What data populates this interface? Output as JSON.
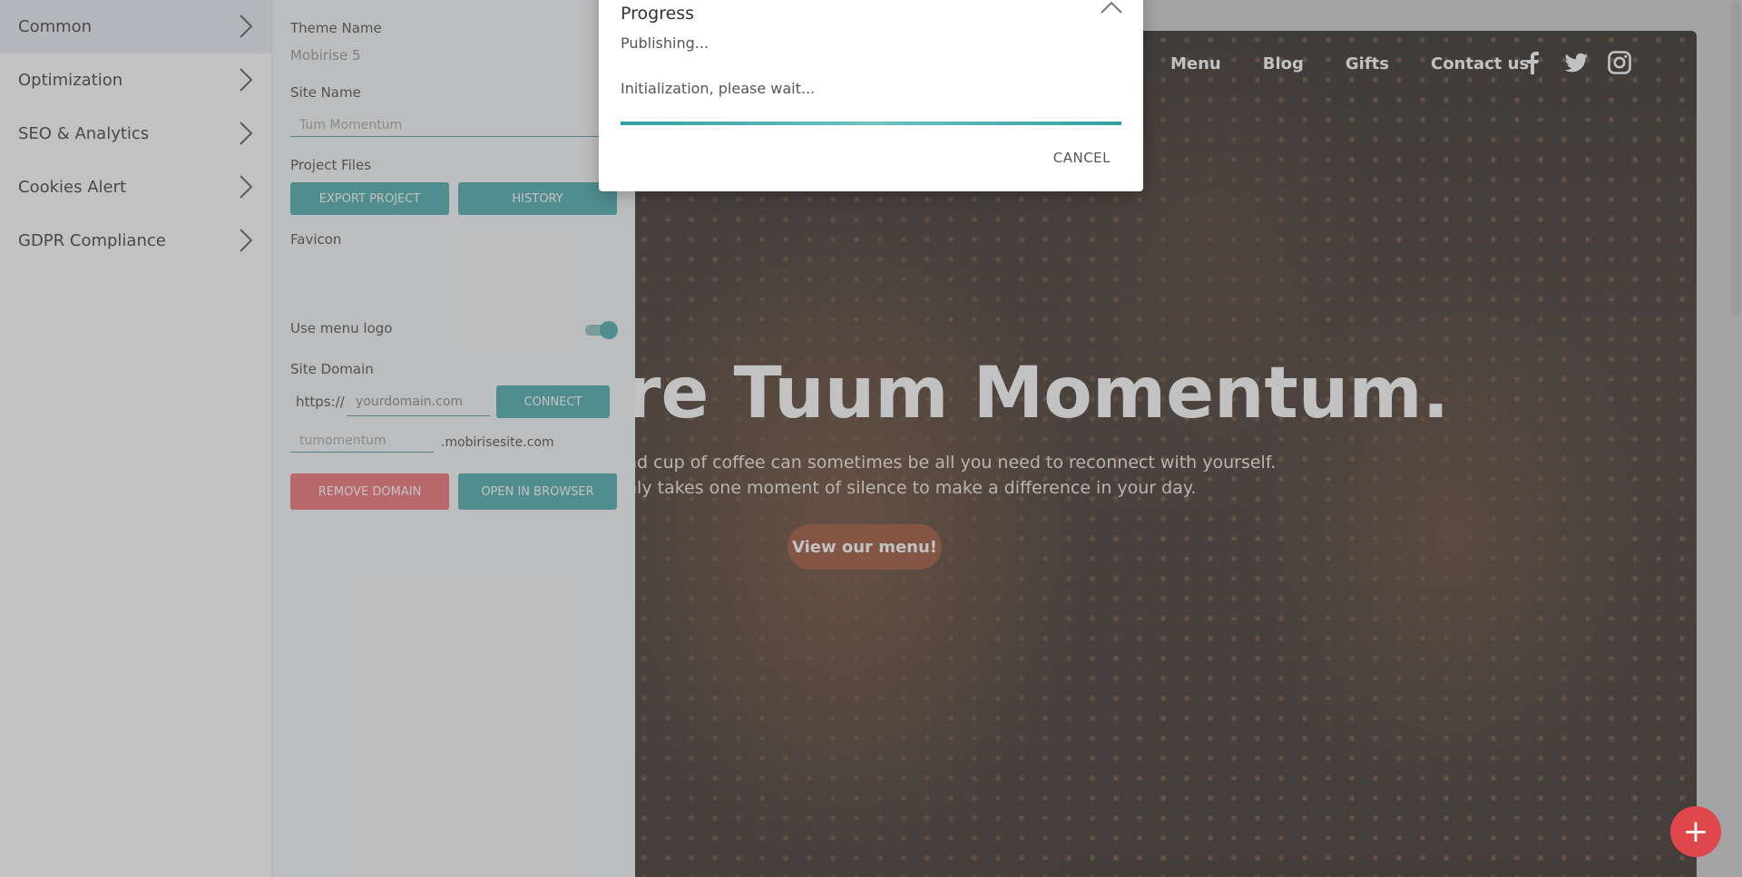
{
  "sidebar": {
    "items": [
      {
        "label": "Common"
      },
      {
        "label": "Optimization"
      },
      {
        "label": "SEO & Analytics"
      },
      {
        "label": "Cookies Alert"
      },
      {
        "label": "GDPR Compliance"
      }
    ]
  },
  "panel": {
    "theme_name_label": "Theme Name",
    "theme_name_value": "Mobirise 5",
    "site_name_label": "Site Name",
    "site_name_value": "Tum Momentum",
    "project_files_label": "Project Files",
    "export_label": "EXPORT PROJECT",
    "history_label": "HISTORY",
    "favicon_label": "Favicon",
    "use_menu_logo_label": "Use menu logo",
    "use_menu_logo_on": true,
    "site_domain_label": "Site Domain",
    "https_prefix": "https://",
    "domain_placeholder": "yourdomain.com",
    "connect_label": "CONNECT",
    "subdomain_value": "tumomentum",
    "subdomain_suffix": ".mobirisesite.com",
    "remove_domain_label": "REMOVE DOMAIN",
    "open_browser_label": "OPEN IN BROWSER"
  },
  "preview": {
    "nav": [
      "Menu",
      "Blog",
      "Gifts",
      "Contact us"
    ],
    "social_icons": [
      "facebook-icon",
      "twitter-icon",
      "instagram-icon"
    ],
    "hero_title": "re Tuum Momentum.",
    "hero_line1": "nd cup of coffee can sometimes be all you need to reconnect with yourself.",
    "hero_line2": "nly takes one moment of silence to make a difference in your day.",
    "hero_button": "View our menu!"
  },
  "modal": {
    "title": "Progress",
    "status": "Publishing...",
    "detail": "Initialization, please wait...",
    "progress": 1.0,
    "cancel_label": "CANCEL"
  },
  "colors": {
    "accent": "#2e9ea1",
    "danger": "#ef5a5f",
    "fab": "#e0474c"
  }
}
